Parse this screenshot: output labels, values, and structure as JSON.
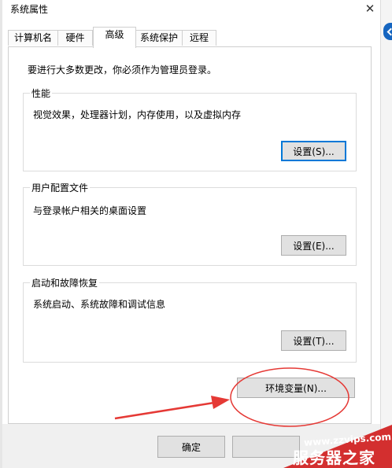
{
  "window": {
    "title": "系统属性"
  },
  "tabs": [
    {
      "label": "计算机名"
    },
    {
      "label": "硬件"
    },
    {
      "label": "高级",
      "active": true
    },
    {
      "label": "系统保护"
    },
    {
      "label": "远程"
    }
  ],
  "intro": "要进行大多数更改，你必须作为管理员登录。",
  "groups": {
    "performance": {
      "title": "性能",
      "desc": "视觉效果，处理器计划，内存使用，以及虚拟内存",
      "button": "设置(S)..."
    },
    "profiles": {
      "title": "用户配置文件",
      "desc": "与登录帐户相关的桌面设置",
      "button": "设置(E)..."
    },
    "startup": {
      "title": "启动和故障恢复",
      "desc": "系统启动、系统故障和调试信息",
      "button": "设置(T)..."
    }
  },
  "env_button": "环境变量(N)...",
  "footer": {
    "ok": "确定"
  },
  "watermark": {
    "url": "www.zzvips.com",
    "name": "服务器之家"
  },
  "colors": {
    "annotation": "#e53935",
    "watermark_bg": "#d32f2f",
    "focus": "#0078d7"
  }
}
